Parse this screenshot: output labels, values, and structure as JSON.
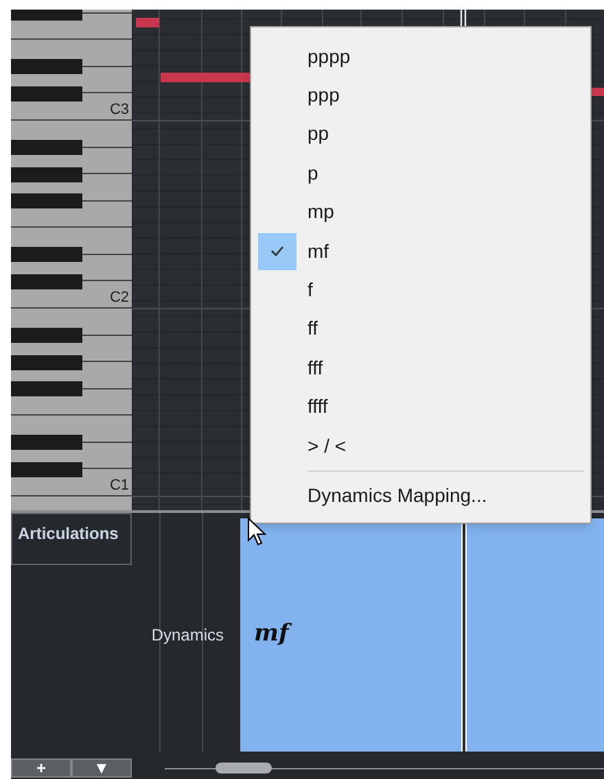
{
  "keyboard": {
    "octave_labels": [
      "C3",
      "C2",
      "C1"
    ]
  },
  "dynamics_menu": {
    "items": [
      {
        "label": "pppp",
        "selected": false
      },
      {
        "label": "ppp",
        "selected": false
      },
      {
        "label": "pp",
        "selected": false
      },
      {
        "label": "p",
        "selected": false
      },
      {
        "label": "mp",
        "selected": false
      },
      {
        "label": "mf",
        "selected": true
      },
      {
        "label": "f",
        "selected": false
      },
      {
        "label": "ff",
        "selected": false
      },
      {
        "label": "fff",
        "selected": false
      },
      {
        "label": "ffff",
        "selected": false
      },
      {
        "label": "> / <",
        "selected": false
      }
    ],
    "footer_item": "Dynamics Mapping..."
  },
  "lanes": {
    "articulations_label": "Articulations",
    "dynamics_label": "Dynamics",
    "dynamics_marking": "mf"
  },
  "footer": {
    "buttons": [
      "+",
      "▼"
    ]
  }
}
